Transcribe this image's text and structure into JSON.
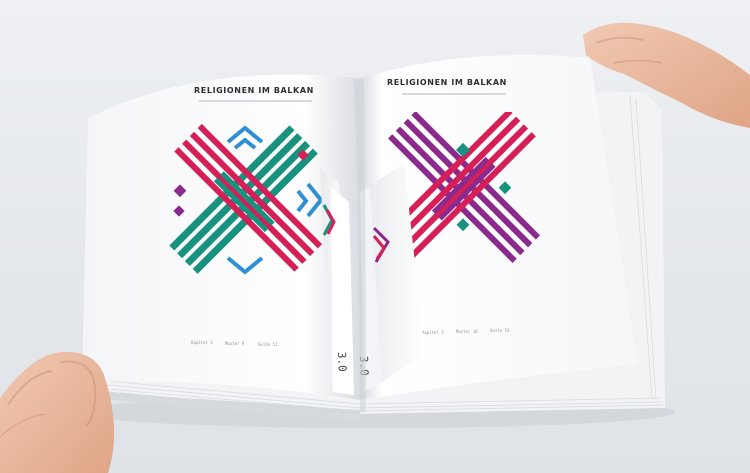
{
  "book": {
    "left_page": {
      "title": "RELIGIONEN IM BALKAN",
      "footer": {
        "chapter": "Kapitel 3",
        "pattern": "Muster 9",
        "page": "Seite 51"
      }
    },
    "right_page": {
      "title": "RELIGIONEN IM BALKAN",
      "footer": {
        "chapter": "Kapitel 3",
        "pattern": "Muster 10",
        "page": "Seite 53"
      }
    },
    "flaps": {
      "left_number": "3.0",
      "right_number": "3.0"
    }
  },
  "colors": {
    "teal": "#16927f",
    "crimson": "#d61f57",
    "sky": "#2f8fd4",
    "purple": "#8a2a8c",
    "magenta": "#c42a70",
    "page": "#ffffff",
    "table": "#e6e9ed"
  }
}
